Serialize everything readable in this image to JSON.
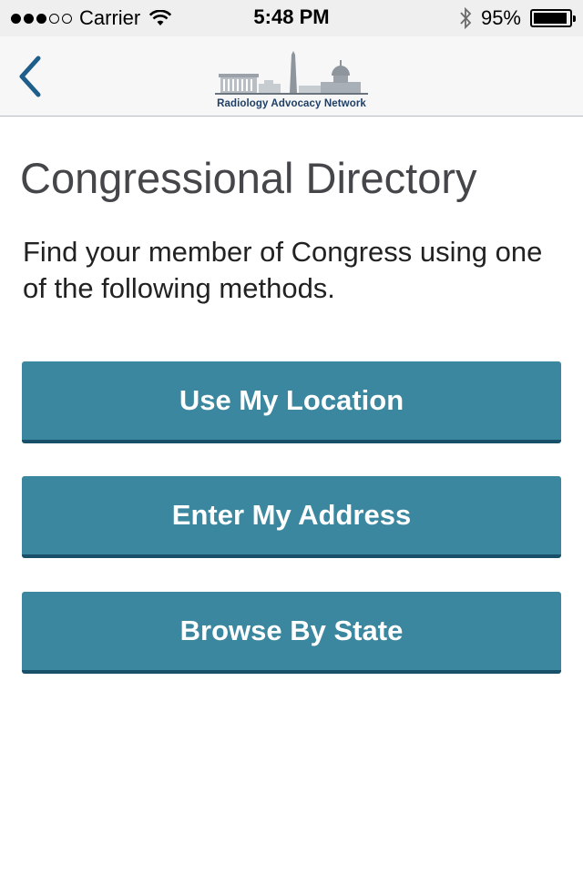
{
  "status_bar": {
    "signal_bars_filled": 3,
    "signal_bars_total": 5,
    "carrier": "Carrier",
    "time": "5:48 PM",
    "battery_percent": "95%",
    "battery_level": 0.95,
    "icons": [
      "wifi-icon",
      "bluetooth-icon",
      "battery-icon"
    ]
  },
  "nav": {
    "back_icon": "chevron-left-icon",
    "logo_text": "Radiology Advocacy Network",
    "accent_color": "#1f5d8a"
  },
  "main": {
    "title": "Congressional Directory",
    "intro": "Find your member of Congress using one of the following methods.",
    "buttons": [
      {
        "label": "Use My Location"
      },
      {
        "label": "Enter My Address"
      },
      {
        "label": "Browse By State"
      }
    ],
    "button_color": "#3a879f",
    "button_shadow_color": "#18506a"
  }
}
